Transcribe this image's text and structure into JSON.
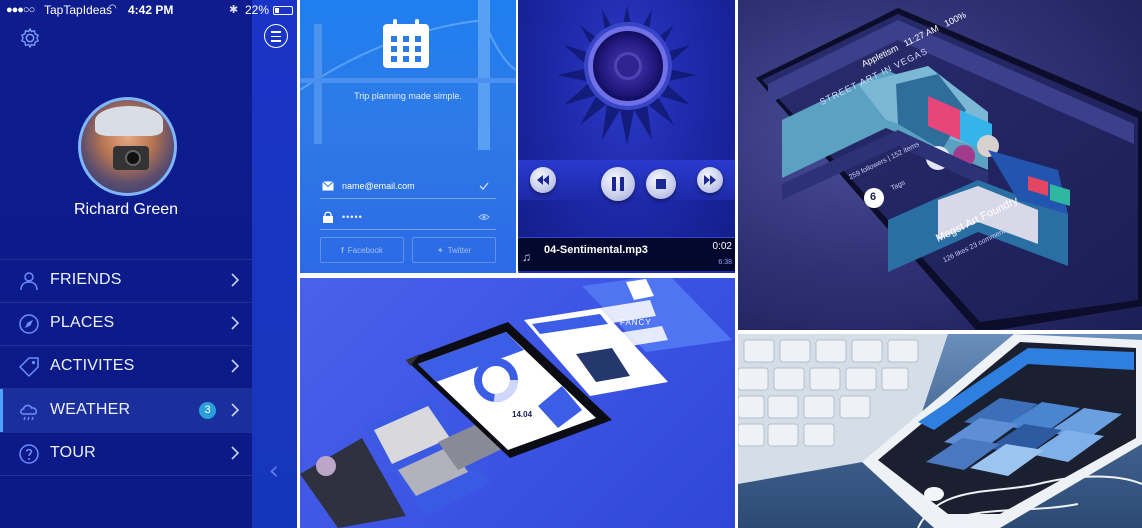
{
  "status_bar": {
    "carrier": "TapTapIdeas",
    "time": "4:42 PM",
    "battery": "22%"
  },
  "profile": {
    "name": "Richard Green"
  },
  "menu": [
    {
      "label": "FRIENDS",
      "icon": "person-icon"
    },
    {
      "label": "PLACES",
      "icon": "compass-icon"
    },
    {
      "label": "ACTIVITES",
      "icon": "tag-icon"
    },
    {
      "label": "WEATHER",
      "icon": "cloud-rain-icon",
      "badge": "3",
      "active": true
    },
    {
      "label": "TOUR",
      "icon": "question-icon"
    }
  ],
  "trip": {
    "tagline": "Trip planning made simple.",
    "email": "name@email.com",
    "password_mask": "•••••",
    "facebook": "Facebook",
    "twitter": "Twitter"
  },
  "player": {
    "track": "04-Sentimental.mp3",
    "elapsed": "0:02",
    "total": "6:38",
    "progress": 0.005
  },
  "street_art": {
    "carrier": "Appletism",
    "time": "11:27 AM",
    "battery": "100%",
    "title": "STREET ART IN VEGAS",
    "stats": "259 followers  |  152 items",
    "tag_count": "6",
    "tags_label": "Tags",
    "venue": "Megst Art Foundry",
    "venue_stats": "126 likes    23 comments"
  },
  "mockup": {
    "app_name": "FANCY",
    "stat": "14.04"
  },
  "colors": {
    "menu_bg": "#0e1c8e",
    "rail_bg": "#1a34c8",
    "accent_badge": "#2b9fd9",
    "trip_bg": "#1f7ff0",
    "music_bg": "#1b26a3"
  }
}
